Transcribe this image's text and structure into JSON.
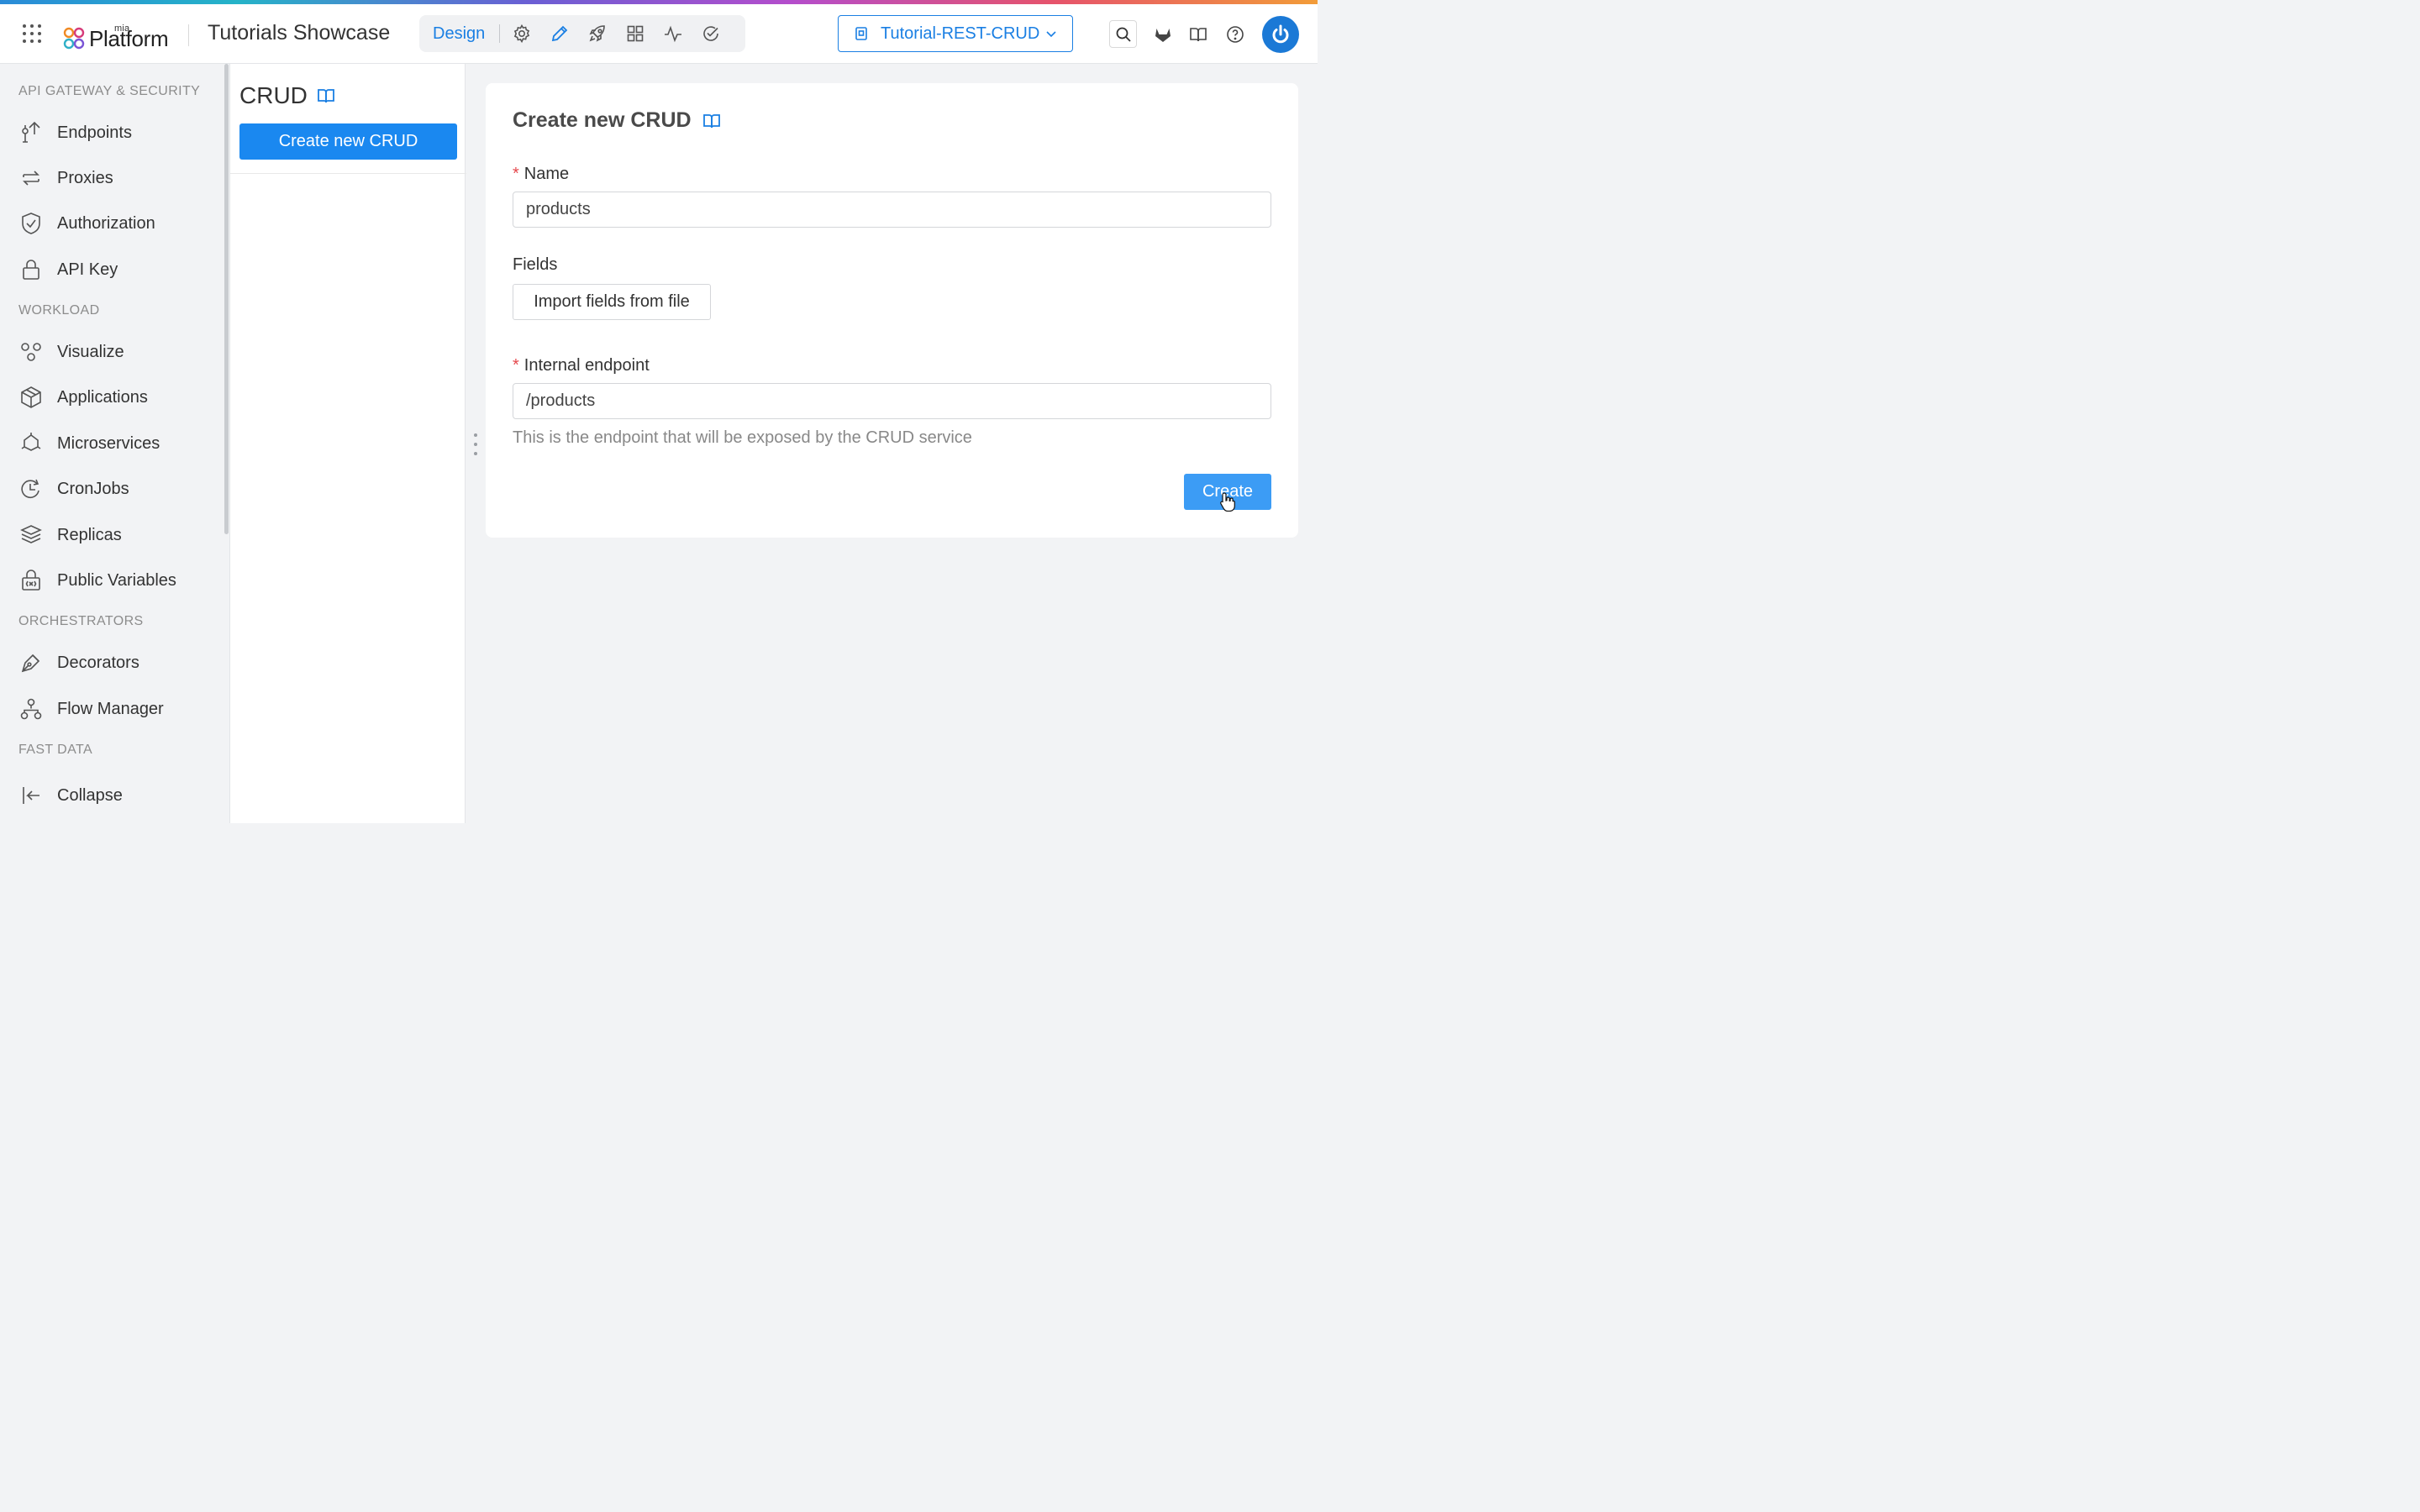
{
  "topbar": {
    "logo_small": "mia",
    "logo_main": "Platform",
    "title": "Tutorials Showcase",
    "nav": {
      "active": "Design",
      "icons": [
        "gear-icon",
        "pencil-icon",
        "rocket-icon",
        "dashboard-icon",
        "pulse-icon",
        "check-circle-icon"
      ]
    },
    "project": "Tutorial-REST-CRUD",
    "right_icons": [
      "search-icon",
      "gitlab-icon",
      "book-icon",
      "help-icon",
      "power-icon"
    ]
  },
  "sidebar": {
    "sections": [
      {
        "title": "API GATEWAY & SECURITY",
        "items": [
          "Endpoints",
          "Proxies",
          "Authorization",
          "API Key"
        ]
      },
      {
        "title": "WORKLOAD",
        "items": [
          "Visualize",
          "Applications",
          "Microservices",
          "CronJobs",
          "Replicas",
          "Public Variables"
        ]
      },
      {
        "title": "ORCHESTRATORS",
        "items": [
          "Decorators",
          "Flow Manager"
        ]
      },
      {
        "title": "FAST DATA",
        "items": []
      }
    ],
    "collapse_label": "Collapse"
  },
  "crud_panel": {
    "title": "CRUD",
    "create_button": "Create new CRUD"
  },
  "form": {
    "title": "Create new CRUD",
    "name_label": "Name",
    "name_value": "products",
    "fields_label": "Fields",
    "import_button": "Import fields from file",
    "endpoint_label": "Internal endpoint",
    "endpoint_value": "/products",
    "endpoint_help": "This is the endpoint that will be exposed by the CRUD service",
    "submit_button": "Create"
  },
  "colors": {
    "primary": "#1a88f0",
    "required": "#e5484d",
    "avatar": "#1b79d6"
  }
}
